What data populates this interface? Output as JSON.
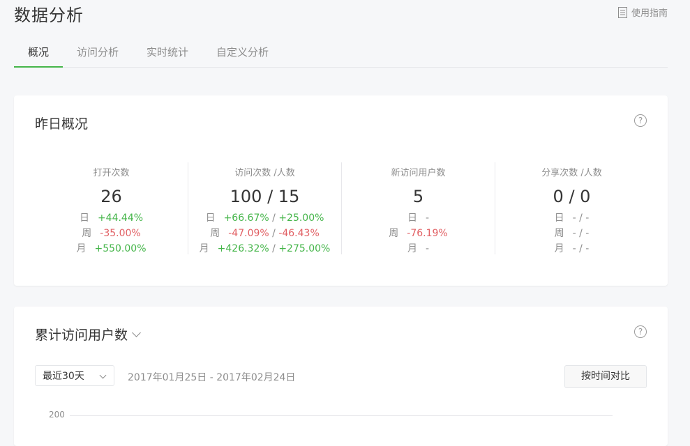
{
  "page": {
    "title": "数据分析"
  },
  "guide": {
    "label": "使用指南"
  },
  "tabs": [
    {
      "label": "概况",
      "active": true
    },
    {
      "label": "访问分析",
      "active": false
    },
    {
      "label": "实时统计",
      "active": false
    },
    {
      "label": "自定义分析",
      "active": false
    }
  ],
  "overview": {
    "title": "昨日概况",
    "help": "?",
    "metrics": [
      {
        "label": "打开次数",
        "value": "26",
        "rows": [
          {
            "key": "日",
            "a": "+44.44%",
            "b": "",
            "sep": ""
          },
          {
            "key": "周",
            "a": "-35.00%",
            "b": "",
            "sep": ""
          },
          {
            "key": "月",
            "a": "+550.00%",
            "b": "",
            "sep": ""
          }
        ]
      },
      {
        "label": "访问次数 /人数",
        "value": "100 / 15",
        "rows": [
          {
            "key": "日",
            "a": "+66.67%",
            "sep": " / ",
            "b": "+25.00%"
          },
          {
            "key": "周",
            "a": "-47.09%",
            "sep": " / ",
            "b": "-46.43%"
          },
          {
            "key": "月",
            "a": "+426.32%",
            "sep": " / ",
            "b": "+275.00%"
          }
        ]
      },
      {
        "label": "新访问用户数",
        "value": "5",
        "rows": [
          {
            "key": "日",
            "a": "-",
            "b": "",
            "sep": ""
          },
          {
            "key": "周",
            "a": "-76.19%",
            "b": "",
            "sep": ""
          },
          {
            "key": "月",
            "a": "-",
            "b": "",
            "sep": ""
          }
        ]
      },
      {
        "label": "分享次数 /人数",
        "value": "0 / 0",
        "rows": [
          {
            "key": "日",
            "a": "- / -",
            "b": "",
            "sep": ""
          },
          {
            "key": "周",
            "a": "- / -",
            "b": "",
            "sep": ""
          },
          {
            "key": "月",
            "a": "- / -",
            "b": "",
            "sep": ""
          }
        ]
      }
    ]
  },
  "cumulative": {
    "title": "累计访问用户数",
    "help": "?",
    "range_select": "最近30天",
    "date_range": "2017年01月25日 - 2017年02月24日",
    "compare_button": "按时间对比",
    "y_tick": "200"
  },
  "colors": {
    "green": "#44b549",
    "red": "#e15f63",
    "grey": "#8d8d8d"
  }
}
